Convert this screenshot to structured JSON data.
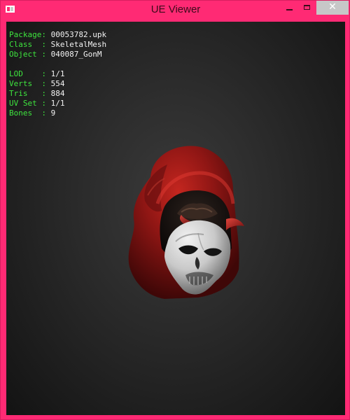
{
  "window": {
    "title": "UE Viewer",
    "controls": {
      "minimize_icon": "minimize-icon",
      "maximize_icon": "maximize-icon",
      "close_icon": "close-icon",
      "close_glyph": "✕"
    },
    "accent": "#ff2a74"
  },
  "info": {
    "rows": [
      {
        "label": "Package: ",
        "value": "00053782.upk"
      },
      {
        "label": "Class  : ",
        "value": "SkeletalMesh"
      },
      {
        "label": "Object : ",
        "value": "040087_GonM"
      },
      {
        "label": "LOD    : ",
        "value": "1/1"
      },
      {
        "label": "Verts  : ",
        "value": "554"
      },
      {
        "label": "Tris   : ",
        "value": "884"
      },
      {
        "label": "UV Set : ",
        "value": "1/1"
      },
      {
        "label": "Bones  : ",
        "value": "9"
      }
    ],
    "label_color": "#3ee43e",
    "value_color": "#f2f2f2"
  },
  "viewport": {
    "model_icon": "hooded-skull-mesh"
  }
}
